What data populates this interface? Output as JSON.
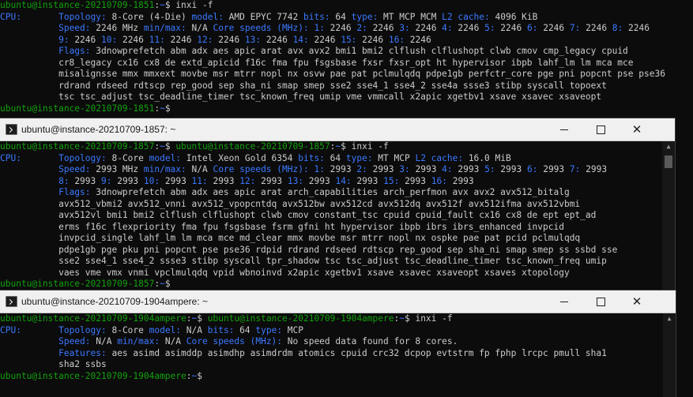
{
  "windows": [
    {
      "id": "w1",
      "title": "",
      "lines": [
        [
          [
            "g",
            "ubuntu@instance-20210709-1851"
          ],
          [
            "w",
            ":"
          ],
          [
            "b",
            "~"
          ],
          [
            "w",
            "$ inxi -f"
          ]
        ],
        [
          [
            "b",
            "CPU:"
          ],
          [
            "w",
            "       "
          ],
          [
            "b",
            "Topology:"
          ],
          [
            "w",
            " 8-Core (4-Die) "
          ],
          [
            "b",
            "model:"
          ],
          [
            "w",
            " AMD EPYC 7742 "
          ],
          [
            "b",
            "bits:"
          ],
          [
            "w",
            " 64 "
          ],
          [
            "b",
            "type:"
          ],
          [
            "w",
            " MT MCP MCM "
          ],
          [
            "b",
            "L2 cache:"
          ],
          [
            "w",
            " 4096 KiB"
          ]
        ],
        [
          [
            "w",
            "           "
          ],
          [
            "b",
            "Speed:"
          ],
          [
            "w",
            " 2246 MHz "
          ],
          [
            "b",
            "min/max:"
          ],
          [
            "w",
            " N/A "
          ],
          [
            "b",
            "Core speeds (MHz):"
          ],
          [
            "w",
            " "
          ],
          [
            "b",
            "1:"
          ],
          [
            "w",
            " 2246 "
          ],
          [
            "b",
            "2:"
          ],
          [
            "w",
            " 2246 "
          ],
          [
            "b",
            "3:"
          ],
          [
            "w",
            " 2246 "
          ],
          [
            "b",
            "4:"
          ],
          [
            "w",
            " 2246 "
          ],
          [
            "b",
            "5:"
          ],
          [
            "w",
            " 2246 "
          ],
          [
            "b",
            "6:"
          ],
          [
            "w",
            " 2246 "
          ],
          [
            "b",
            "7:"
          ],
          [
            "w",
            " 2246 "
          ],
          [
            "b",
            "8:"
          ],
          [
            "w",
            " 2246"
          ]
        ],
        [
          [
            "w",
            "           "
          ],
          [
            "b",
            "9:"
          ],
          [
            "w",
            " 2246 "
          ],
          [
            "b",
            "10:"
          ],
          [
            "w",
            " 2246 "
          ],
          [
            "b",
            "11:"
          ],
          [
            "w",
            " 2246 "
          ],
          [
            "b",
            "12:"
          ],
          [
            "w",
            " 2246 "
          ],
          [
            "b",
            "13:"
          ],
          [
            "w",
            " 2246 "
          ],
          [
            "b",
            "14:"
          ],
          [
            "w",
            " 2246 "
          ],
          [
            "b",
            "15:"
          ],
          [
            "w",
            " 2246 "
          ],
          [
            "b",
            "16:"
          ],
          [
            "w",
            " 2246"
          ]
        ],
        [
          [
            "w",
            "           "
          ],
          [
            "b",
            "Flags:"
          ],
          [
            "w",
            " 3dnowprefetch abm adx aes apic arat avx avx2 bmi1 bmi2 clflush clflushopt clwb cmov cmp_legacy cpuid"
          ]
        ],
        [
          [
            "w",
            "           cr8_legacy cx16 cx8 de extd_apicid f16c fma fpu fsgsbase fxsr fxsr_opt ht hypervisor ibpb lahf_lm lm mca mce"
          ]
        ],
        [
          [
            "w",
            "           misalignsse mmx mmxext movbe msr mtrr nopl nx osvw pae pat pclmulqdq pdpe1gb perfctr_core pge pni popcnt pse pse36"
          ]
        ],
        [
          [
            "w",
            "           rdrand rdseed rdtscp rep_good sep sha_ni smap smep sse2 sse4_1 sse4_2 sse4a ssse3 stibp syscall topoext"
          ]
        ],
        [
          [
            "w",
            "           tsc tsc_adjust tsc_deadline_timer tsc_known_freq umip vme vmmcall x2apic xgetbv1 xsave xsavec xsaveopt"
          ]
        ],
        [
          [
            "g",
            "ubuntu@instance-20210709-1851"
          ],
          [
            "w",
            ":"
          ],
          [
            "b",
            "~"
          ],
          [
            "w",
            "$ "
          ]
        ]
      ]
    },
    {
      "id": "w2",
      "title": "ubuntu@instance-20210709-1857: ~",
      "lines": [
        [
          [
            "g",
            "ubuntu@instance-20210709-1857"
          ],
          [
            "w",
            ":"
          ],
          [
            "b",
            "~"
          ],
          [
            "w",
            "$ "
          ],
          [
            "g",
            "ubuntu@instance-20210709-1857"
          ],
          [
            "w",
            ":"
          ],
          [
            "b",
            "~"
          ],
          [
            "w",
            "$ inxi -f"
          ]
        ],
        [
          [
            "b",
            "CPU:"
          ],
          [
            "w",
            "       "
          ],
          [
            "b",
            "Topology:"
          ],
          [
            "w",
            " 8-Core "
          ],
          [
            "b",
            "model:"
          ],
          [
            "w",
            " Intel Xeon Gold 6354 "
          ],
          [
            "b",
            "bits:"
          ],
          [
            "w",
            " 64 "
          ],
          [
            "b",
            "type:"
          ],
          [
            "w",
            " MT MCP "
          ],
          [
            "b",
            "L2 cache:"
          ],
          [
            "w",
            " 16.0 MiB"
          ]
        ],
        [
          [
            "w",
            "           "
          ],
          [
            "b",
            "Speed:"
          ],
          [
            "w",
            " 2993 MHz "
          ],
          [
            "b",
            "min/max:"
          ],
          [
            "w",
            " N/A "
          ],
          [
            "b",
            "Core speeds (MHz):"
          ],
          [
            "w",
            " "
          ],
          [
            "b",
            "1:"
          ],
          [
            "w",
            " 2993 "
          ],
          [
            "b",
            "2:"
          ],
          [
            "w",
            " 2993 "
          ],
          [
            "b",
            "3:"
          ],
          [
            "w",
            " 2993 "
          ],
          [
            "b",
            "4:"
          ],
          [
            "w",
            " 2993 "
          ],
          [
            "b",
            "5:"
          ],
          [
            "w",
            " 2993 "
          ],
          [
            "b",
            "6:"
          ],
          [
            "w",
            " 2993 "
          ],
          [
            "b",
            "7:"
          ],
          [
            "w",
            " 2993"
          ]
        ],
        [
          [
            "w",
            "           "
          ],
          [
            "b",
            "8:"
          ],
          [
            "w",
            " 2993 "
          ],
          [
            "b",
            "9:"
          ],
          [
            "w",
            " 2993 "
          ],
          [
            "b",
            "10:"
          ],
          [
            "w",
            " 2993 "
          ],
          [
            "b",
            "11:"
          ],
          [
            "w",
            " 2993 "
          ],
          [
            "b",
            "12:"
          ],
          [
            "w",
            " 2993 "
          ],
          [
            "b",
            "13:"
          ],
          [
            "w",
            " 2993 "
          ],
          [
            "b",
            "14:"
          ],
          [
            "w",
            " 2993 "
          ],
          [
            "b",
            "15:"
          ],
          [
            "w",
            " 2993 "
          ],
          [
            "b",
            "16:"
          ],
          [
            "w",
            " 2993"
          ]
        ],
        [
          [
            "w",
            "           "
          ],
          [
            "b",
            "Flags:"
          ],
          [
            "w",
            " 3dnowprefetch abm adx aes apic arat arch_capabilities arch_perfmon avx avx2 avx512_bitalg"
          ]
        ],
        [
          [
            "w",
            "           avx512_vbmi2 avx512_vnni avx512_vpopcntdq avx512bw avx512cd avx512dq avx512f avx512ifma avx512vbmi"
          ]
        ],
        [
          [
            "w",
            "           avx512vl bmi1 bmi2 clflush clflushopt clwb cmov constant_tsc cpuid cpuid_fault cx16 cx8 de ept ept_ad"
          ]
        ],
        [
          [
            "w",
            "           erms f16c flexpriority fma fpu fsgsbase fsrm gfni ht hypervisor ibpb ibrs ibrs_enhanced invpcid"
          ]
        ],
        [
          [
            "w",
            "           invpcid_single lahf_lm lm mca mce md_clear mmx movbe msr mtrr nopl nx ospke pae pat pcid pclmulqdq"
          ]
        ],
        [
          [
            "w",
            "           pdpe1gb pge pku pni popcnt pse pse36 rdpid rdrand rdseed rdtscp rep_good sep sha_ni smap smep ss ssbd sse"
          ]
        ],
        [
          [
            "w",
            "           sse2 sse4_1 sse4_2 ssse3 stibp syscall tpr_shadow tsc tsc_adjust tsc_deadline_timer tsc_known_freq umip"
          ]
        ],
        [
          [
            "w",
            "           vaes vme vmx vnmi vpclmulqdq vpid wbnoinvd x2apic xgetbv1 xsave xsavec xsaveopt xsaves xtopology"
          ]
        ],
        [
          [
            "g",
            "ubuntu@instance-20210709-1857"
          ],
          [
            "w",
            ":"
          ],
          [
            "b",
            "~"
          ],
          [
            "w",
            "$ "
          ]
        ]
      ]
    },
    {
      "id": "w3",
      "title": "ubuntu@instance-20210709-1904ampere: ~",
      "lines": [
        [
          [
            "g",
            "ubuntu@instance-20210709-1904ampere"
          ],
          [
            "w",
            ":"
          ],
          [
            "b",
            "~"
          ],
          [
            "w",
            "$ "
          ],
          [
            "g",
            "ubuntu@instance-20210709-1904ampere"
          ],
          [
            "w",
            ":"
          ],
          [
            "b",
            "~"
          ],
          [
            "w",
            "$ inxi -f"
          ]
        ],
        [
          [
            "b",
            "CPU:"
          ],
          [
            "w",
            "       "
          ],
          [
            "b",
            "Topology:"
          ],
          [
            "w",
            " 8-Core "
          ],
          [
            "b",
            "model:"
          ],
          [
            "w",
            " N/A "
          ],
          [
            "b",
            "bits:"
          ],
          [
            "w",
            " 64 "
          ],
          [
            "b",
            "type:"
          ],
          [
            "w",
            " MCP"
          ]
        ],
        [
          [
            "w",
            "           "
          ],
          [
            "b",
            "Speed:"
          ],
          [
            "w",
            " N/A "
          ],
          [
            "b",
            "min/max:"
          ],
          [
            "w",
            " N/A "
          ],
          [
            "b",
            "Core speeds (MHz):"
          ],
          [
            "w",
            " No speed data found for 8 cores."
          ]
        ],
        [
          [
            "w",
            "           "
          ],
          [
            "b",
            "Features:"
          ],
          [
            "w",
            " aes asimd asimddp asimdhp asimdrdm atomics cpuid crc32 dcpop evtstrm fp fphp lrcpc pmull sha1"
          ]
        ],
        [
          [
            "w",
            "           sha2 ssbs"
          ]
        ],
        [
          [
            "g",
            "ubuntu@instance-20210709-1904ampere"
          ],
          [
            "w",
            ":"
          ],
          [
            "b",
            "~"
          ],
          [
            "w",
            "$ "
          ]
        ]
      ]
    }
  ]
}
